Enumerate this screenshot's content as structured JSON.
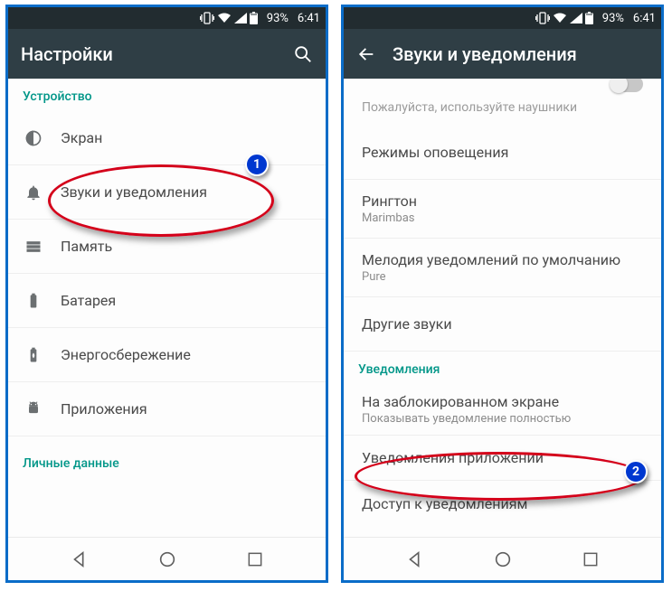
{
  "status": {
    "battery_pct": "93%",
    "time": "6:41"
  },
  "left": {
    "title": "Настройки",
    "section_device": "Устройство",
    "items": {
      "display": "Экран",
      "sound": "Звуки и уведомления",
      "storage": "Память",
      "battery": "Батарея",
      "powersave": "Энергосбережение",
      "apps": "Приложения"
    },
    "section_personal": "Личные данные"
  },
  "right": {
    "title": "Звуки и уведомления",
    "hint": "Пожалуйста, используйте наушники",
    "items": {
      "alert_modes": "Режимы оповещения",
      "ringtone": {
        "title": "Рингтон",
        "sub": "Marimbas"
      },
      "default_notif": {
        "title": "Мелодия уведомлений по умолчанию",
        "sub": "Pure"
      },
      "other_sounds": "Другие звуки"
    },
    "section_notif": "Уведомления",
    "notif_items": {
      "lockscreen": {
        "title": "На заблокированном экране",
        "sub": "Показывать уведомление полностью"
      },
      "app_notif": "Уведомления приложений",
      "notif_access": "Доступ к уведомлениям"
    }
  },
  "annotations": {
    "badge1": "1",
    "badge2": "2"
  }
}
